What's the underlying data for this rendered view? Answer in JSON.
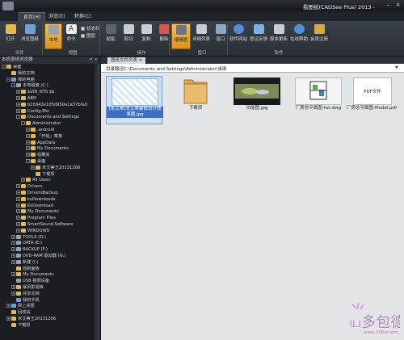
{
  "window": {
    "title": "看图纸(CADSee Plus) 2013 -"
  },
  "ribbon_tabs": [
    "首页(H)",
    "浏览(E)",
    "转换(C)"
  ],
  "ribbon": {
    "file": {
      "open": "打开",
      "browse": "浏览图纸",
      "group": "文件"
    },
    "view": {
      "local": "本地",
      "cmd": "命令",
      "statusbar": "状态栏",
      "layer": "图层",
      "group": "视图"
    },
    "ops": {
      "paste": "粘贴",
      "cut": "剪切",
      "copy": "复制",
      "delete": "删除",
      "group": "操作"
    },
    "window": {
      "thumb": "缩略图",
      "detail": "详细列表",
      "win": "窗口",
      "group": "窗口"
    },
    "software": {
      "site": "软件网站",
      "feedback": "意见反馈",
      "update": "版本更新",
      "help": "在线帮助",
      "register": "会员注册",
      "group": "软件"
    }
  },
  "left_panel": {
    "title": "本机图纸浏览器"
  },
  "tree": [
    {
      "label": "桌面",
      "depth": 0,
      "exp": "-",
      "icon": "folder"
    },
    {
      "label": "我的文档",
      "depth": 1,
      "exp": "",
      "icon": "folder"
    },
    {
      "label": "我的电脑",
      "depth": 1,
      "exp": "-",
      "icon": "pc"
    },
    {
      "label": "本地磁盘 (C:)",
      "depth": 2,
      "exp": "-",
      "icon": "drive"
    },
    {
      "label": "$VIN_NTS $$",
      "depth": 3,
      "exp": "+",
      "icon": "folder"
    },
    {
      "label": "ABD",
      "depth": 3,
      "exp": "+",
      "icon": "folder"
    },
    {
      "label": "b20d42e105d950a1a57bfa0",
      "depth": 3,
      "exp": "+",
      "icon": "folder"
    },
    {
      "label": "Config.Msi",
      "depth": 3,
      "exp": "+",
      "icon": "folder"
    },
    {
      "label": "Documents and Settings",
      "depth": 3,
      "exp": "-",
      "icon": "folder"
    },
    {
      "label": "Administrator",
      "depth": 4,
      "exp": "-",
      "icon": "folder"
    },
    {
      "label": ".android",
      "depth": 5,
      "exp": "+",
      "icon": "folder"
    },
    {
      "label": "「开始」菜单",
      "depth": 5,
      "exp": "+",
      "icon": "folder"
    },
    {
      "label": "AppData",
      "depth": 5,
      "exp": "+",
      "icon": "folder"
    },
    {
      "label": "My Documents",
      "depth": 5,
      "exp": "+",
      "icon": "folder"
    },
    {
      "label": "收藏夹",
      "depth": 5,
      "exp": "+",
      "icon": "folder"
    },
    {
      "label": "桌面",
      "depth": 5,
      "exp": "-",
      "icon": "folder"
    },
    {
      "label": "米艾蒂王20131206",
      "depth": 6,
      "exp": "+",
      "icon": "folder"
    },
    {
      "label": "下载坝",
      "depth": 6,
      "exp": "",
      "icon": "folder"
    },
    {
      "label": "All Users",
      "depth": 4,
      "exp": "+",
      "icon": "folder"
    },
    {
      "label": "Drivers",
      "depth": 3,
      "exp": "+",
      "icon": "folder"
    },
    {
      "label": "DriversBackup",
      "depth": 3,
      "exp": "+",
      "icon": "folder"
    },
    {
      "label": "kuDownloads",
      "depth": 3,
      "exp": "+",
      "icon": "folder"
    },
    {
      "label": "KsDownload",
      "depth": 3,
      "exp": "+",
      "icon": "folder"
    },
    {
      "label": "My Documents",
      "depth": 3,
      "exp": "+",
      "icon": "folder"
    },
    {
      "label": "Program Files",
      "depth": 3,
      "exp": "+",
      "icon": "folder"
    },
    {
      "label": "SmartSound Software",
      "depth": 3,
      "exp": "+",
      "icon": "folder"
    },
    {
      "label": "WINDOWS",
      "depth": 3,
      "exp": "+",
      "icon": "folder"
    },
    {
      "label": "TOOLS (D:)",
      "depth": 2,
      "exp": "+",
      "icon": "drive"
    },
    {
      "label": "DATA (E:)",
      "depth": 2,
      "exp": "+",
      "icon": "drive"
    },
    {
      "label": "BACKUP (F:)",
      "depth": 2,
      "exp": "+",
      "icon": "drive"
    },
    {
      "label": "DVD-RAM 驱动器 (G:)",
      "depth": 2,
      "exp": "+",
      "icon": "drive"
    },
    {
      "label": "新建 (I:)",
      "depth": 2,
      "exp": "+",
      "icon": "drive"
    },
    {
      "label": "控制面板",
      "depth": 2,
      "exp": "",
      "icon": "folder"
    },
    {
      "label": "My Documents",
      "depth": 2,
      "exp": "+",
      "icon": "folder"
    },
    {
      "label": "USB 视频设备",
      "depth": 2,
      "exp": "",
      "icon": "drive"
    },
    {
      "label": "暴风影视库",
      "depth": 2,
      "exp": "+",
      "icon": "folder"
    },
    {
      "label": "共享文档",
      "depth": 2,
      "exp": "+",
      "icon": "folder"
    },
    {
      "label": "我的手机",
      "depth": 2,
      "exp": "",
      "icon": "pc"
    },
    {
      "label": "网上邻居",
      "depth": 1,
      "exp": "+",
      "icon": "pc"
    },
    {
      "label": "回收站",
      "depth": 1,
      "exp": "",
      "icon": "folder"
    },
    {
      "label": "米艾蒂王20131206",
      "depth": 1,
      "exp": "+",
      "icon": "folder"
    },
    {
      "label": "下载坝",
      "depth": 1,
      "exp": "",
      "icon": "folder"
    }
  ],
  "main": {
    "tab": "图纸文件列表",
    "path_label": "目录路径：",
    "path": "C:\\Documents and Settings\\Administrator\\桌面",
    "files": [
      {
        "name": "[米艾蒂]米艾蒂装修设计效果图.jpg",
        "kind": "image",
        "selected": true
      },
      {
        "name": "下载坝",
        "kind": "folder",
        "selected": false
      },
      {
        "name": "功能图.jpg",
        "kind": "photo",
        "selected": false
      },
      {
        "name": "厂房总平面图-fas.dwg",
        "kind": "dwg",
        "selected": false
      },
      {
        "name": "厂房总平面图-Model.pdf",
        "kind": "pdf",
        "selected": false
      }
    ],
    "pdf_text": "PDF文件"
  },
  "watermark": {
    "text": "www.386w.com"
  }
}
